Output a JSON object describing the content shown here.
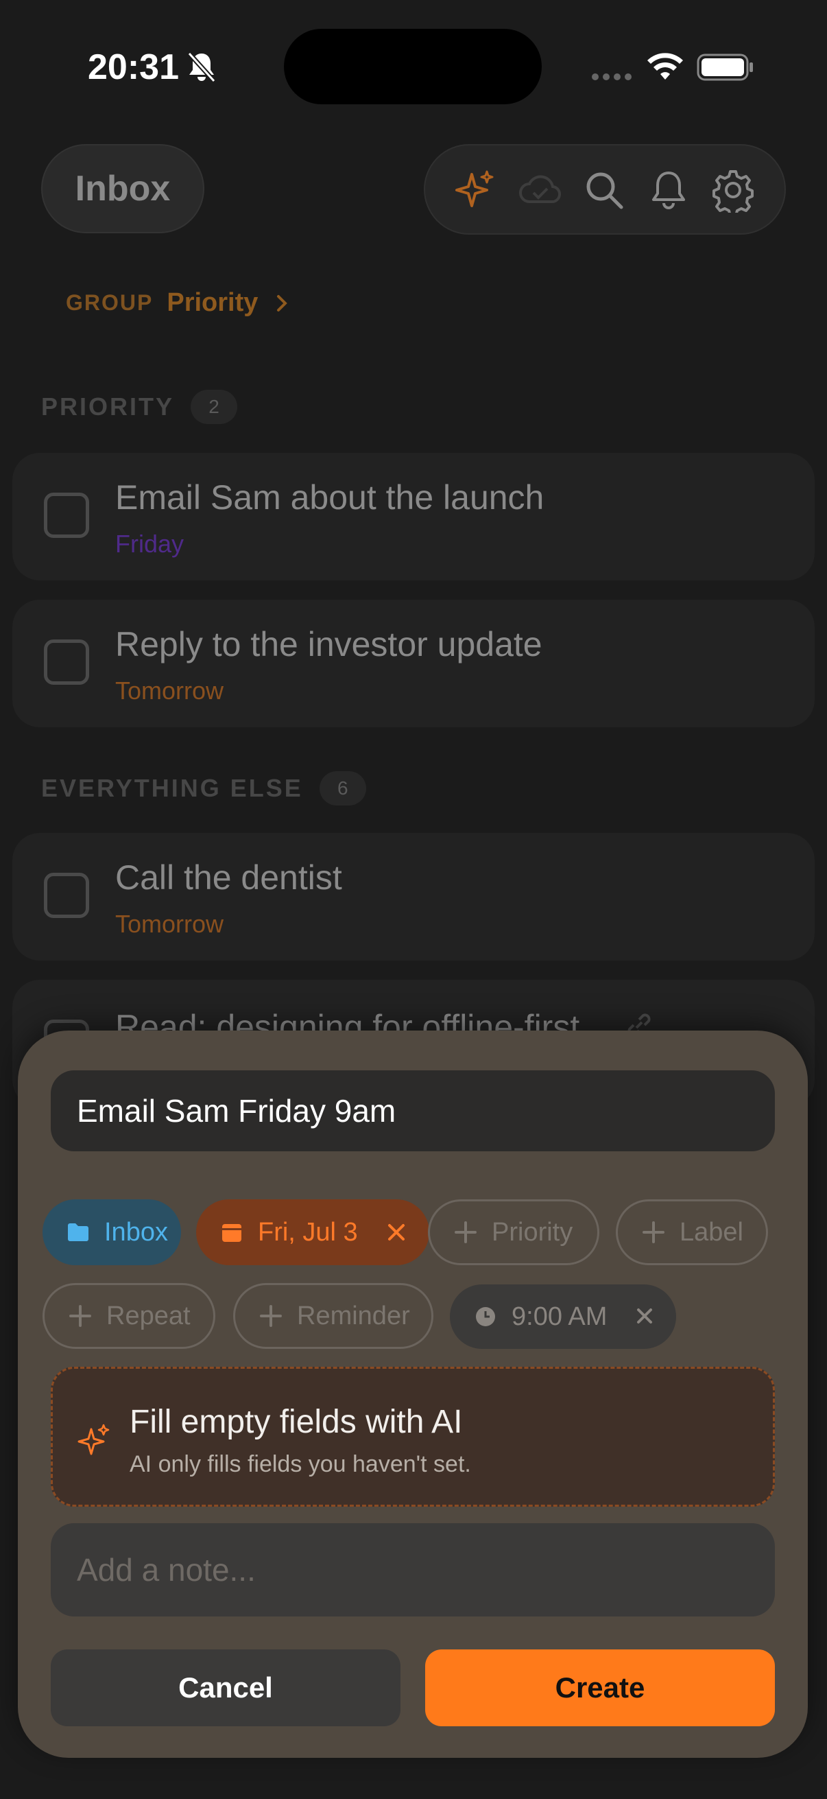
{
  "status_bar": {
    "time": "20:31"
  },
  "header": {
    "inbox_title": "Inbox",
    "group_label": "GROUP",
    "group_value": "Priority",
    "icons": [
      "sparkles-icon",
      "cloud-check-icon",
      "search-icon",
      "bell-icon",
      "gear-icon"
    ]
  },
  "sections": {
    "priority": {
      "title": "PRIORITY",
      "count": "2"
    },
    "everything_else": {
      "title": "EVERYTHING ELSE",
      "count": "6"
    }
  },
  "tasks": [
    {
      "title": "Email Sam about the launch",
      "due": "Friday",
      "due_color": "#4f2a8a"
    },
    {
      "title": "Reply to the investor update",
      "due": "Tomorrow",
      "due_color": "#8a501e"
    },
    {
      "title": "Call the dentist",
      "due": "Tomorrow",
      "due_color": "#8a501e"
    },
    {
      "title": "Read: designing for offline-first",
      "due": "",
      "due_color": ""
    }
  ],
  "sheet": {
    "title_value": "Email Sam Friday 9am",
    "chips": {
      "inbox": "Inbox",
      "date": "Fri, Jul 3",
      "priority": "Priority",
      "label": "Label",
      "repeat": "Repeat",
      "reminder": "Reminder",
      "time": "9:00 AM"
    },
    "ai": {
      "title": "Fill empty fields with AI",
      "subtitle": "AI only fills fields you haven't set."
    },
    "note_placeholder": "Add a note...",
    "cancel_label": "Cancel",
    "create_label": "Create"
  },
  "colors": {
    "accent": "#ff7a1a",
    "inbox_chip": "#4fb3ec",
    "sheet_bg": "#514940"
  }
}
